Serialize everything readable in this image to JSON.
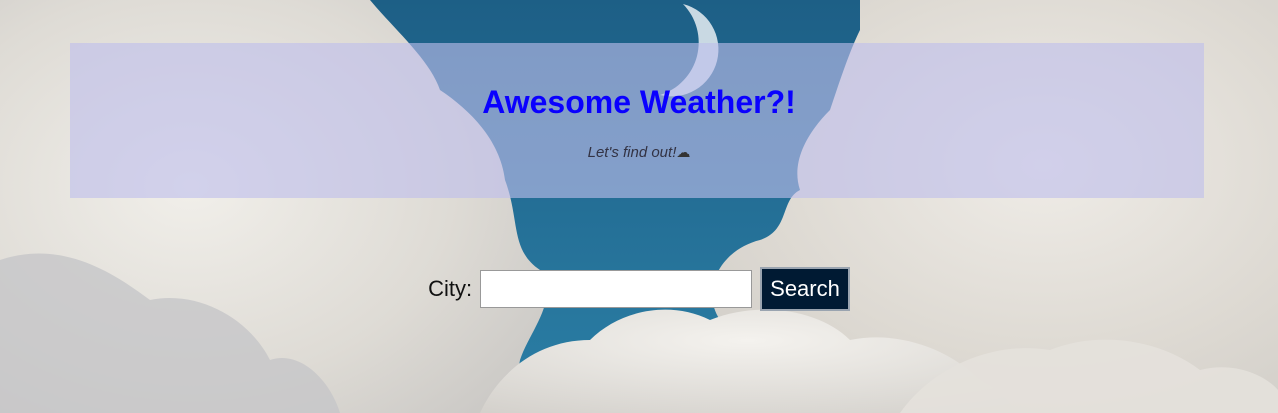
{
  "header": {
    "title": "Awesome Weather?!",
    "subtitle": "Let's find out!",
    "subtitle_icon": "cloud-icon"
  },
  "search": {
    "label": "City:",
    "value": "",
    "placeholder": "",
    "button_label": "Search"
  },
  "colors": {
    "title": "#0a00ff",
    "header_background": "rgba(190,190,235,0.62)",
    "button_background": "#001a33",
    "sky": "#1e6e96"
  }
}
